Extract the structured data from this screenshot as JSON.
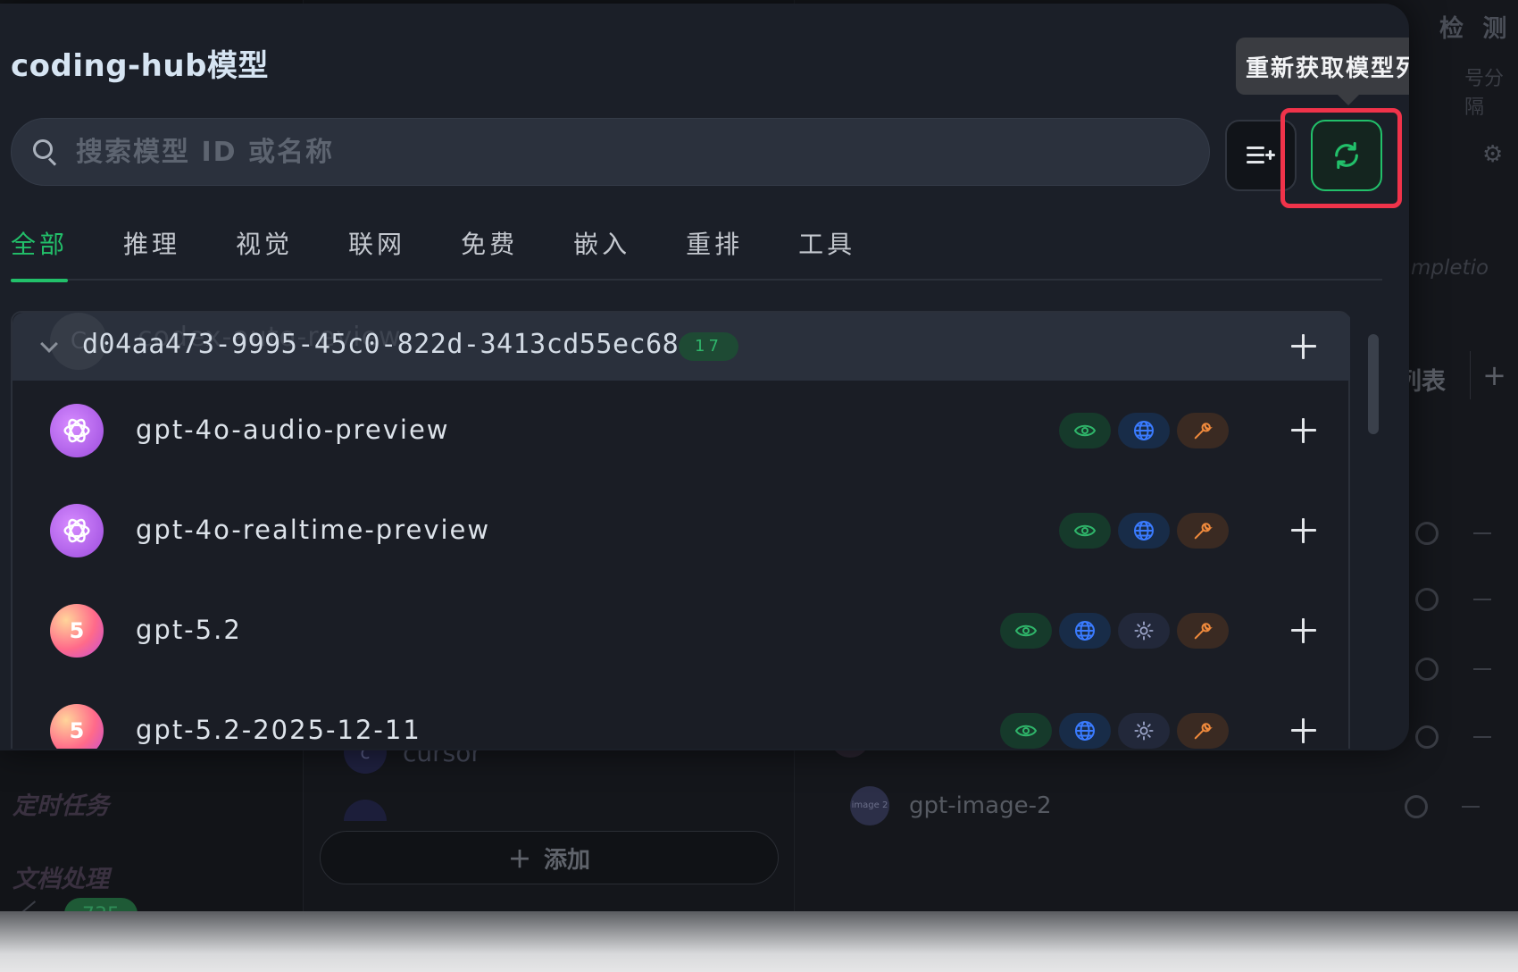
{
  "background": {
    "nav": [
      "定时任务",
      "文档处理"
    ],
    "add_button": {
      "icon": "plus-icon",
      "label": "添加"
    },
    "cursor_item": {
      "avatar": "c",
      "name": "cursor"
    },
    "right_title": "检 测",
    "right_sub": "号分隔",
    "right_completion": "mpletio",
    "right_list_label": "列表",
    "gpt_image": {
      "avatar": "image 2",
      "name": "gpt-image-2"
    },
    "badge": "735"
  },
  "dialog": {
    "title": "coding-hub模型",
    "search": {
      "placeholder": "搜索模型 ID 或名称",
      "value": ""
    },
    "tooltip": "重新获取模型列表",
    "tabs": [
      {
        "label": "全部",
        "active": true
      },
      {
        "label": "推理",
        "active": false
      },
      {
        "label": "视觉",
        "active": false
      },
      {
        "label": "联网",
        "active": false
      },
      {
        "label": "免费",
        "active": false
      },
      {
        "label": "嵌入",
        "active": false
      },
      {
        "label": "重排",
        "active": false
      },
      {
        "label": "工具",
        "active": false
      }
    ],
    "group": {
      "id": "d04aa473-9995-45c0-822d-3413cd55ec68",
      "count": "17",
      "ghost_avatar": "C",
      "ghost_text": "codex-auto-review"
    },
    "models": [
      {
        "name": "gpt-4o-audio-preview",
        "avatar": "openai-logo",
        "avatar_text": "",
        "caps": [
          "vision",
          "web",
          "tool"
        ]
      },
      {
        "name": "gpt-4o-realtime-preview",
        "avatar": "openai-logo",
        "avatar_text": "",
        "caps": [
          "vision",
          "web",
          "tool"
        ]
      },
      {
        "name": "gpt-5.2",
        "avatar": "gpt5-logo",
        "avatar_text": "5",
        "caps": [
          "vision",
          "web",
          "reason",
          "tool"
        ]
      },
      {
        "name": "gpt-5.2-2025-12-11",
        "avatar": "gpt5-logo",
        "avatar_text": "5",
        "caps": [
          "vision",
          "web",
          "reason",
          "tool"
        ]
      }
    ],
    "colors": {
      "accent": "#22c06a",
      "highlight": "#f0334a",
      "vision": "#2fb56a",
      "web": "#3a7bff",
      "reason": "#9aa3c7",
      "tool": "#f08a3c"
    }
  }
}
